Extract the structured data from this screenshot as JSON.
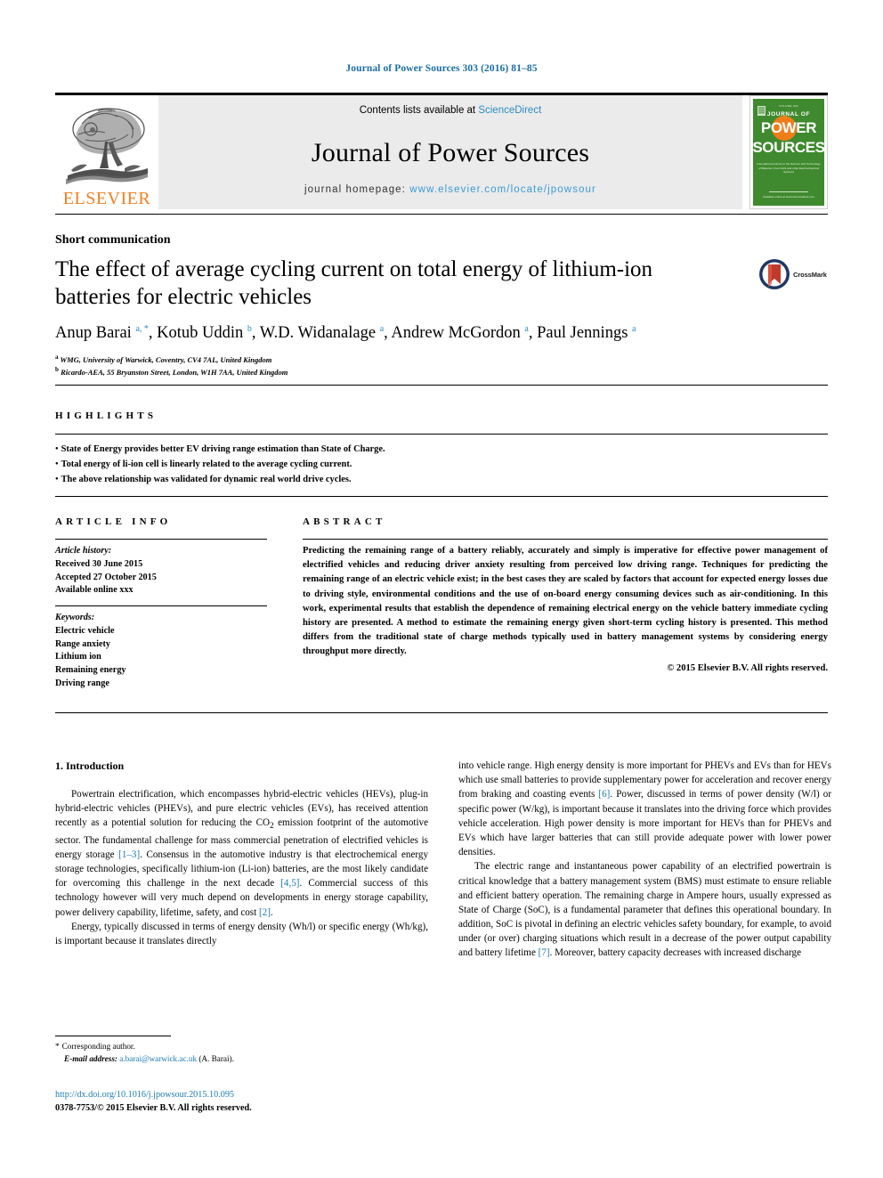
{
  "running_head": "Journal of Power Sources 303 (2016) 81–85",
  "masthead": {
    "contents_prefix": "Contents lists available at ",
    "sciencedirect": "ScienceDirect",
    "journal_title": "Journal of Power Sources",
    "homepage_prefix": "journal homepage: ",
    "homepage_url": "www.elsevier.com/locate/jpowsour",
    "publisher": "ELSEVIER",
    "cover": {
      "top_issue": "VOLUME 303",
      "journal_of": "JOURNAL OF",
      "power": "POWER",
      "sources": "SOURCES",
      "blurb": "International journal on the Science and Technology of Batteries, Fuel Cells and other Electrochemical Systems",
      "footer": "Available online at www.sciencedirect.com"
    },
    "accent_orange": "#f08122",
    "accent_blue": "#2b8cc4",
    "cover_green": "#3f8a2e"
  },
  "article": {
    "type": "Short communication",
    "title": "The effect of average cycling current on total energy of lithium-ion batteries for electric vehicles",
    "crossmark_label": "CrossMark",
    "authors_html": "Anup Barai <sup>a, *</sup>, Kotub Uddin <sup>b</sup>, W.D. Widanalage <sup>a</sup>, Andrew McGordon <sup>a</sup>, Paul Jennings <sup>a</sup>",
    "affiliations": [
      "WMG, University of Warwick, Coventry, CV4 7AL, United Kingdom",
      "Ricardo-AEA, 55 Bryanston Street, London, W1H 7AA, United Kingdom"
    ]
  },
  "highlights": {
    "label": "HIGHLIGHTS",
    "items": [
      "State of Energy provides better EV driving range estimation than State of Charge.",
      "Total energy of li-ion cell is linearly related to the average cycling current.",
      "The above relationship was validated for dynamic real world drive cycles."
    ]
  },
  "article_info": {
    "label": "ARTICLE INFO",
    "history_head": "Article history:",
    "history": [
      "Received 30 June 2015",
      "Accepted 27 October 2015",
      "Available online xxx"
    ],
    "keywords_head": "Keywords:",
    "keywords": [
      "Electric vehicle",
      "Range anxiety",
      "Lithium ion",
      "Remaining energy",
      "Driving range"
    ]
  },
  "abstract": {
    "label": "ABSTRACT",
    "text": "Predicting the remaining range of a battery reliably, accurately and simply is imperative for effective power management of electrified vehicles and reducing driver anxiety resulting from perceived low driving range. Techniques for predicting the remaining range of an electric vehicle exist; in the best cases they are scaled by factors that account for expected energy losses due to driving style, environmental conditions and the use of on-board energy consuming devices such as air-conditioning. In this work, experimental results that establish the dependence of remaining electrical energy on the vehicle battery immediate cycling history are presented. A method to estimate the remaining energy given short-term cycling history is presented. This method differs from the traditional state of charge methods typically used in battery management systems by considering energy throughput more directly.",
    "copyright": "© 2015 Elsevier B.V. All rights reserved."
  },
  "body": {
    "section_heading": "1. Introduction",
    "left_paragraphs": [
      "Powertrain electrification, which encompasses hybrid-electric vehicles (HEVs), plug-in hybrid-electric vehicles (PHEVs), and pure electric vehicles (EVs), has received attention recently as a potential solution for reducing the CO<sub>2</sub> emission footprint of the automotive sector. The fundamental challenge for mass commercial penetration of electrified vehicles is energy storage <span class=\"cite\">[1–3]</span>. Consensus in the automotive industry is that electrochemical energy storage technologies, specifically lithium-ion (Li-ion) batteries, are the most likely candidate for overcoming this challenge in the next decade <span class=\"cite\">[4,5]</span>. Commercial success of this technology however will very much depend on developments in energy storage capability, power delivery capability, lifetime, safety, and cost <span class=\"cite\">[2]</span>.",
      "Energy, typically discussed in terms of energy density (Wh/l) or specific energy (Wh/kg), is important because it translates directly"
    ],
    "right_paragraphs": [
      "into vehicle range. High energy density is more important for PHEVs and EVs than for HEVs which use small batteries to provide supplementary power for acceleration and recover energy from braking and coasting events <span class=\"cite\">[6]</span>. Power, discussed in terms of power density (W/l) or specific power (W/kg), is important because it translates into the driving force which provides vehicle acceleration. High power density is more important for HEVs than for PHEVs and EVs which have larger batteries that can still provide adequate power with lower power densities.",
      "The electric range and instantaneous power capability of an electrified powertrain is critical knowledge that a battery management system (BMS) must estimate to ensure reliable and efficient battery operation. The remaining charge in Ampere hours, usually expressed as State of Charge (SoC), is a fundamental parameter that defines this operational boundary. In addition, SoC is pivotal in defining an electric vehicles safety boundary, for example, to avoid under (or over) charging situations which result in a decrease of the power output capability and battery lifetime <span class=\"cite\">[7]</span>. Moreover, battery capacity decreases with increased discharge"
    ]
  },
  "footnote": {
    "corresponding": "Corresponding author.",
    "email_label": "E-mail address:",
    "email": "a.barai@warwick.ac.uk",
    "email_suffix": "(A. Barai).",
    "doi": "http://dx.doi.org/10.1016/j.jpowsour.2015.10.095",
    "issn_line": "0378-7753/© 2015 Elsevier B.V. All rights reserved."
  }
}
